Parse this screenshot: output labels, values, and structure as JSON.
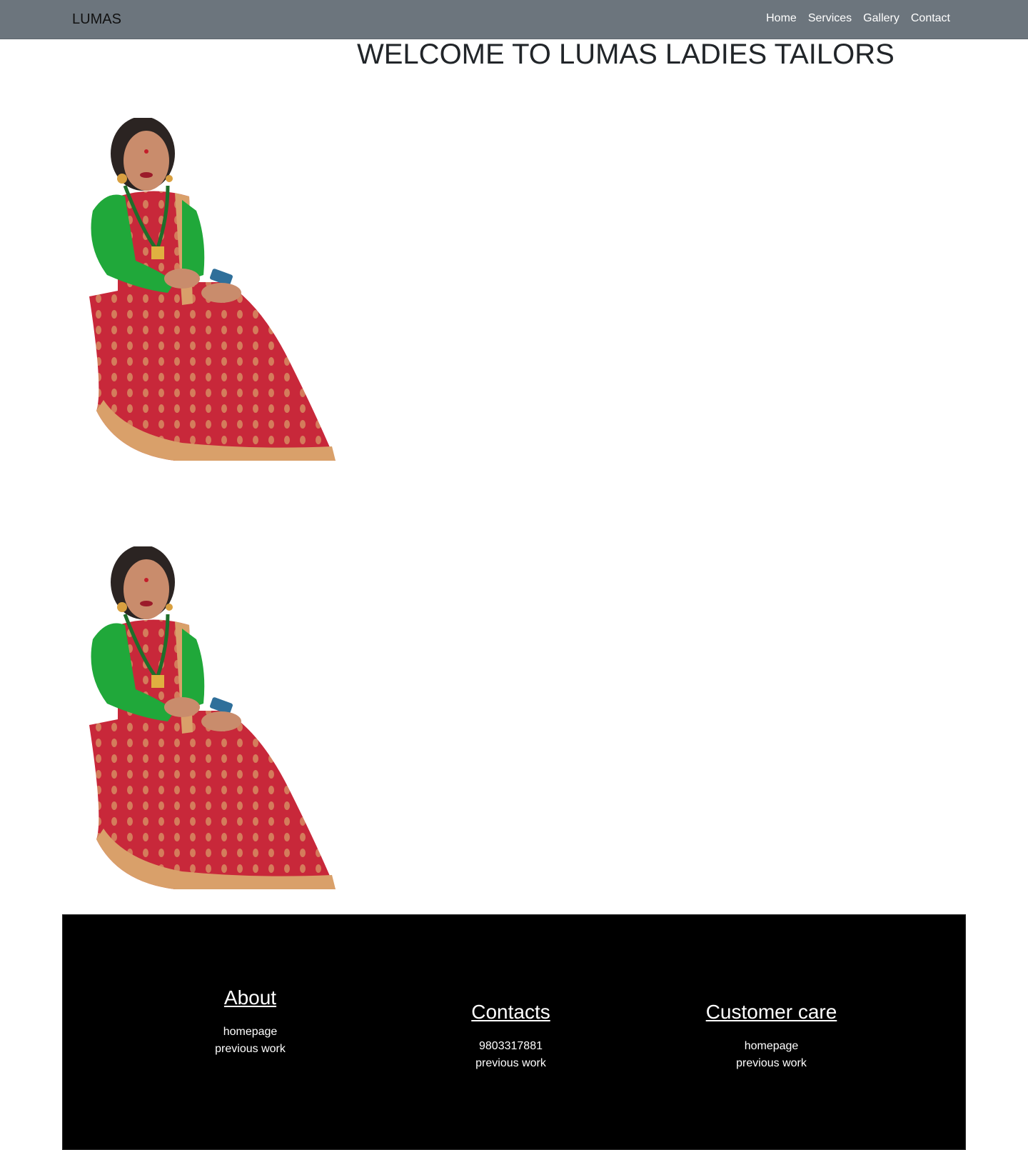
{
  "navbar": {
    "brand": "LUMAS",
    "links": [
      {
        "label": "Home"
      },
      {
        "label": "Services"
      },
      {
        "label": "Gallery"
      },
      {
        "label": "Contact"
      }
    ],
    "background": "#6c757d"
  },
  "hero": {
    "title": "WELCOME TO LUMAS LADIES TAILORS"
  },
  "footer": {
    "background": "#000000",
    "columns": [
      {
        "heading": "About",
        "lines": [
          "homepage",
          "previous work"
        ]
      },
      {
        "heading": "Contacts",
        "lines": [
          "9803317881",
          "previous work"
        ]
      },
      {
        "heading": "Customer care",
        "lines": [
          "homepage",
          "previous work"
        ]
      }
    ]
  }
}
